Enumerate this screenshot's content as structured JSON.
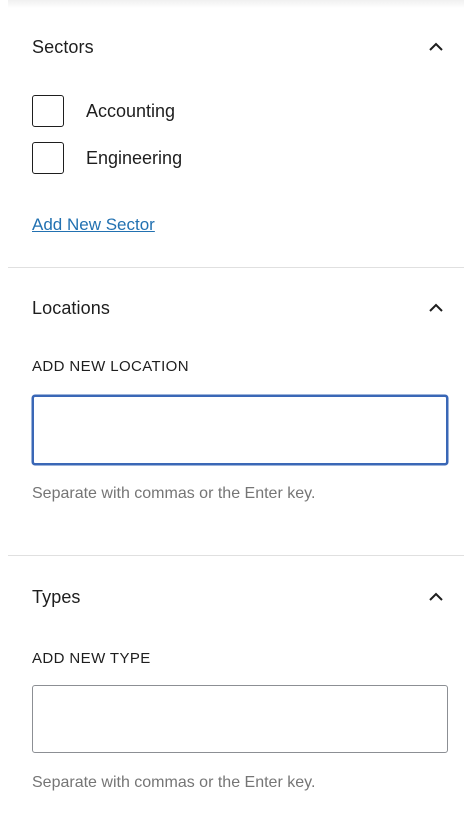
{
  "sectors": {
    "title": "Sectors",
    "items": [
      {
        "label": "Accounting",
        "checked": false
      },
      {
        "label": "Engineering",
        "checked": false
      }
    ],
    "add_link": "Add New Sector",
    "expanded": true
  },
  "locations": {
    "title": "Locations",
    "field_label": "ADD NEW LOCATION",
    "input_value": "",
    "help": "Separate with commas or the Enter key.",
    "expanded": true
  },
  "types": {
    "title": "Types",
    "field_label": "ADD NEW TYPE",
    "input_value": "",
    "help": "Separate with commas or the Enter key.",
    "expanded": true
  },
  "icons": {
    "collapse": "chevron-up-icon"
  }
}
